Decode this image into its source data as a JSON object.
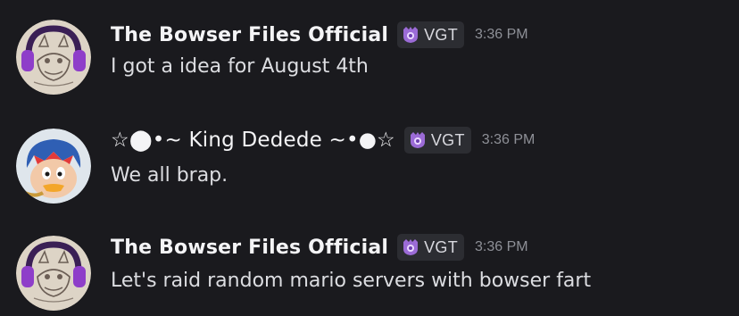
{
  "colors": {
    "background": "#1a1a1e",
    "tag_background": "#2c2d32",
    "username": "#f4f4f6",
    "message_text": "#dcdde1",
    "timestamp": "#8e9097",
    "tag_icon": "#9b6bd6"
  },
  "messages": [
    {
      "username": "The Bowser Files Official",
      "avatar_icon": "bowser-sketch-headphones-avatar",
      "tag": {
        "icon": "crown-shield-icon",
        "label": "VGT"
      },
      "time": "3:36 PM",
      "content": "I got a idea for August 4th"
    },
    {
      "username": "☆⬤•~ King Dedede ~•●☆",
      "avatar_icon": "king-dedede-avatar",
      "tag": {
        "icon": "crown-shield-icon",
        "label": "VGT"
      },
      "time": "3:36 PM",
      "content": "We all brap."
    },
    {
      "username": "The Bowser Files Official",
      "avatar_icon": "bowser-sketch-headphones-avatar",
      "tag": {
        "icon": "crown-shield-icon",
        "label": "VGT"
      },
      "time": "3:36 PM",
      "content": "Let's raid random mario servers with bowser fart"
    }
  ]
}
